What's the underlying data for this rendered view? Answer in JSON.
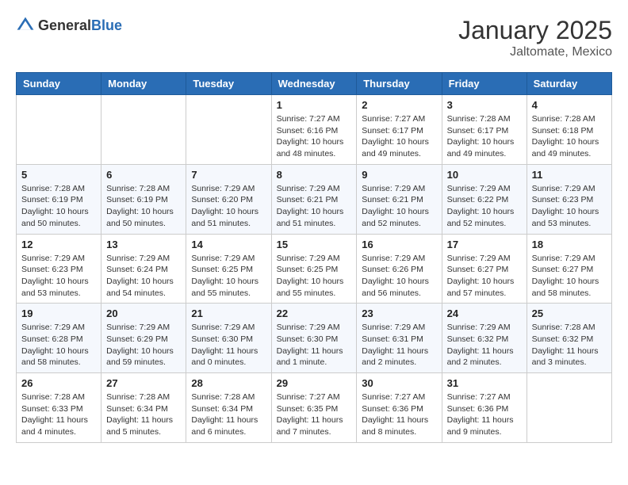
{
  "header": {
    "logo_general": "General",
    "logo_blue": "Blue",
    "month": "January 2025",
    "location": "Jaltomate, Mexico"
  },
  "weekdays": [
    "Sunday",
    "Monday",
    "Tuesday",
    "Wednesday",
    "Thursday",
    "Friday",
    "Saturday"
  ],
  "weeks": [
    [
      {
        "day": "",
        "sunrise": "",
        "sunset": "",
        "daylight": ""
      },
      {
        "day": "",
        "sunrise": "",
        "sunset": "",
        "daylight": ""
      },
      {
        "day": "",
        "sunrise": "",
        "sunset": "",
        "daylight": ""
      },
      {
        "day": "1",
        "sunrise": "Sunrise: 7:27 AM",
        "sunset": "Sunset: 6:16 PM",
        "daylight": "Daylight: 10 hours and 48 minutes."
      },
      {
        "day": "2",
        "sunrise": "Sunrise: 7:27 AM",
        "sunset": "Sunset: 6:17 PM",
        "daylight": "Daylight: 10 hours and 49 minutes."
      },
      {
        "day": "3",
        "sunrise": "Sunrise: 7:28 AM",
        "sunset": "Sunset: 6:17 PM",
        "daylight": "Daylight: 10 hours and 49 minutes."
      },
      {
        "day": "4",
        "sunrise": "Sunrise: 7:28 AM",
        "sunset": "Sunset: 6:18 PM",
        "daylight": "Daylight: 10 hours and 49 minutes."
      }
    ],
    [
      {
        "day": "5",
        "sunrise": "Sunrise: 7:28 AM",
        "sunset": "Sunset: 6:19 PM",
        "daylight": "Daylight: 10 hours and 50 minutes."
      },
      {
        "day": "6",
        "sunrise": "Sunrise: 7:28 AM",
        "sunset": "Sunset: 6:19 PM",
        "daylight": "Daylight: 10 hours and 50 minutes."
      },
      {
        "day": "7",
        "sunrise": "Sunrise: 7:29 AM",
        "sunset": "Sunset: 6:20 PM",
        "daylight": "Daylight: 10 hours and 51 minutes."
      },
      {
        "day": "8",
        "sunrise": "Sunrise: 7:29 AM",
        "sunset": "Sunset: 6:21 PM",
        "daylight": "Daylight: 10 hours and 51 minutes."
      },
      {
        "day": "9",
        "sunrise": "Sunrise: 7:29 AM",
        "sunset": "Sunset: 6:21 PM",
        "daylight": "Daylight: 10 hours and 52 minutes."
      },
      {
        "day": "10",
        "sunrise": "Sunrise: 7:29 AM",
        "sunset": "Sunset: 6:22 PM",
        "daylight": "Daylight: 10 hours and 52 minutes."
      },
      {
        "day": "11",
        "sunrise": "Sunrise: 7:29 AM",
        "sunset": "Sunset: 6:23 PM",
        "daylight": "Daylight: 10 hours and 53 minutes."
      }
    ],
    [
      {
        "day": "12",
        "sunrise": "Sunrise: 7:29 AM",
        "sunset": "Sunset: 6:23 PM",
        "daylight": "Daylight: 10 hours and 53 minutes."
      },
      {
        "day": "13",
        "sunrise": "Sunrise: 7:29 AM",
        "sunset": "Sunset: 6:24 PM",
        "daylight": "Daylight: 10 hours and 54 minutes."
      },
      {
        "day": "14",
        "sunrise": "Sunrise: 7:29 AM",
        "sunset": "Sunset: 6:25 PM",
        "daylight": "Daylight: 10 hours and 55 minutes."
      },
      {
        "day": "15",
        "sunrise": "Sunrise: 7:29 AM",
        "sunset": "Sunset: 6:25 PM",
        "daylight": "Daylight: 10 hours and 55 minutes."
      },
      {
        "day": "16",
        "sunrise": "Sunrise: 7:29 AM",
        "sunset": "Sunset: 6:26 PM",
        "daylight": "Daylight: 10 hours and 56 minutes."
      },
      {
        "day": "17",
        "sunrise": "Sunrise: 7:29 AM",
        "sunset": "Sunset: 6:27 PM",
        "daylight": "Daylight: 10 hours and 57 minutes."
      },
      {
        "day": "18",
        "sunrise": "Sunrise: 7:29 AM",
        "sunset": "Sunset: 6:27 PM",
        "daylight": "Daylight: 10 hours and 58 minutes."
      }
    ],
    [
      {
        "day": "19",
        "sunrise": "Sunrise: 7:29 AM",
        "sunset": "Sunset: 6:28 PM",
        "daylight": "Daylight: 10 hours and 58 minutes."
      },
      {
        "day": "20",
        "sunrise": "Sunrise: 7:29 AM",
        "sunset": "Sunset: 6:29 PM",
        "daylight": "Daylight: 10 hours and 59 minutes."
      },
      {
        "day": "21",
        "sunrise": "Sunrise: 7:29 AM",
        "sunset": "Sunset: 6:30 PM",
        "daylight": "Daylight: 11 hours and 0 minutes."
      },
      {
        "day": "22",
        "sunrise": "Sunrise: 7:29 AM",
        "sunset": "Sunset: 6:30 PM",
        "daylight": "Daylight: 11 hours and 1 minute."
      },
      {
        "day": "23",
        "sunrise": "Sunrise: 7:29 AM",
        "sunset": "Sunset: 6:31 PM",
        "daylight": "Daylight: 11 hours and 2 minutes."
      },
      {
        "day": "24",
        "sunrise": "Sunrise: 7:29 AM",
        "sunset": "Sunset: 6:32 PM",
        "daylight": "Daylight: 11 hours and 2 minutes."
      },
      {
        "day": "25",
        "sunrise": "Sunrise: 7:28 AM",
        "sunset": "Sunset: 6:32 PM",
        "daylight": "Daylight: 11 hours and 3 minutes."
      }
    ],
    [
      {
        "day": "26",
        "sunrise": "Sunrise: 7:28 AM",
        "sunset": "Sunset: 6:33 PM",
        "daylight": "Daylight: 11 hours and 4 minutes."
      },
      {
        "day": "27",
        "sunrise": "Sunrise: 7:28 AM",
        "sunset": "Sunset: 6:34 PM",
        "daylight": "Daylight: 11 hours and 5 minutes."
      },
      {
        "day": "28",
        "sunrise": "Sunrise: 7:28 AM",
        "sunset": "Sunset: 6:34 PM",
        "daylight": "Daylight: 11 hours and 6 minutes."
      },
      {
        "day": "29",
        "sunrise": "Sunrise: 7:27 AM",
        "sunset": "Sunset: 6:35 PM",
        "daylight": "Daylight: 11 hours and 7 minutes."
      },
      {
        "day": "30",
        "sunrise": "Sunrise: 7:27 AM",
        "sunset": "Sunset: 6:36 PM",
        "daylight": "Daylight: 11 hours and 8 minutes."
      },
      {
        "day": "31",
        "sunrise": "Sunrise: 7:27 AM",
        "sunset": "Sunset: 6:36 PM",
        "daylight": "Daylight: 11 hours and 9 minutes."
      },
      {
        "day": "",
        "sunrise": "",
        "sunset": "",
        "daylight": ""
      }
    ]
  ]
}
